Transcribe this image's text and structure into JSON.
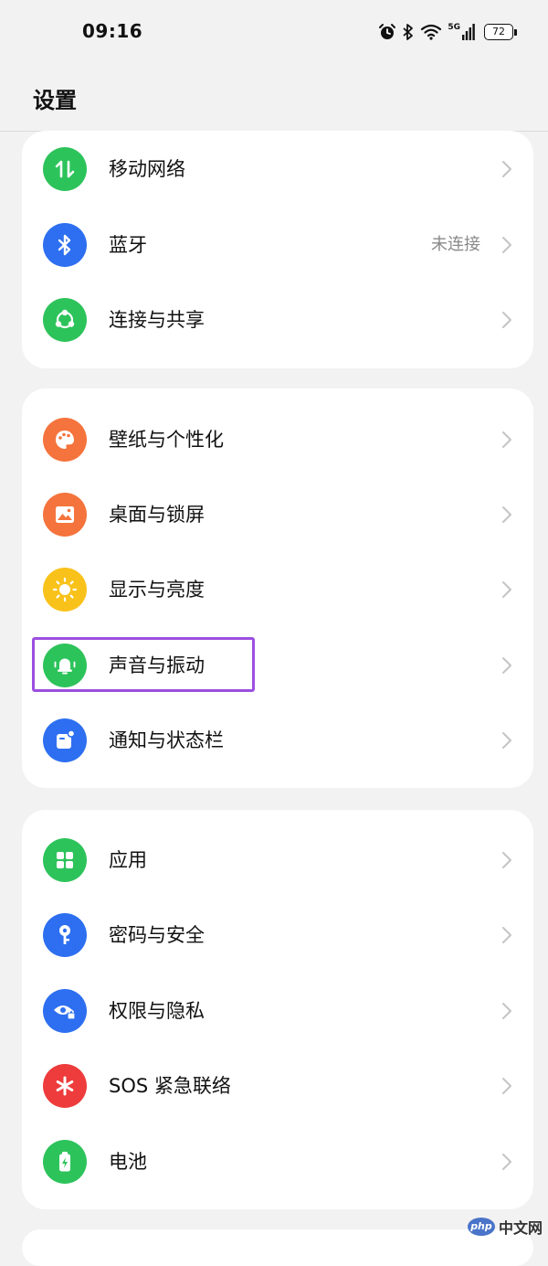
{
  "status_bar": {
    "time": "09:16",
    "network_label": "5G",
    "battery_level": "72"
  },
  "header": {
    "title": "设置"
  },
  "groups": [
    {
      "items": [
        {
          "label": "移动网络",
          "icon": "arrows-updown-icon",
          "color": "#2dc35b",
          "value": ""
        },
        {
          "label": "蓝牙",
          "icon": "bluetooth-icon",
          "color": "#2d6ff0",
          "value": "未连接"
        },
        {
          "label": "连接与共享",
          "icon": "share-icon",
          "color": "#2dc35b",
          "value": ""
        }
      ]
    },
    {
      "items": [
        {
          "label": "壁纸与个性化",
          "icon": "palette-icon",
          "color": "#f5733c",
          "value": ""
        },
        {
          "label": "桌面与锁屏",
          "icon": "image-icon",
          "color": "#f5733c",
          "value": ""
        },
        {
          "label": "显示与亮度",
          "icon": "sun-icon",
          "color": "#f9c21b",
          "value": ""
        },
        {
          "label": "声音与振动",
          "icon": "bell-icon",
          "color": "#2dc35b",
          "value": ""
        },
        {
          "label": "通知与状态栏",
          "icon": "notification-icon",
          "color": "#2d6ff0",
          "value": ""
        }
      ]
    },
    {
      "items": [
        {
          "label": "应用",
          "icon": "apps-grid-icon",
          "color": "#2dc35b",
          "value": ""
        },
        {
          "label": "密码与安全",
          "icon": "key-icon",
          "color": "#2d6ff0",
          "value": ""
        },
        {
          "label": "权限与隐私",
          "icon": "privacy-eye-icon",
          "color": "#2d6ff0",
          "value": ""
        },
        {
          "label": "SOS 紧急联络",
          "icon": "asterisk-icon",
          "color": "#ee3b3b",
          "value": ""
        },
        {
          "label": "电池",
          "icon": "battery-charging-icon",
          "color": "#2dc35b",
          "value": ""
        }
      ]
    }
  ],
  "watermark": {
    "badge": "php",
    "text": "中文网"
  }
}
